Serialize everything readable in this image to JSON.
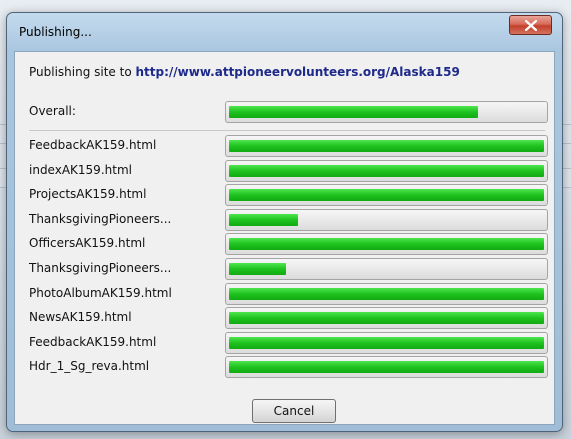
{
  "window": {
    "title": "Publishing..."
  },
  "header": {
    "prefix": "Publishing site to",
    "url": "http://www.attpioneervolunteers.org/Alaska159"
  },
  "overall": {
    "label": "Overall:",
    "progress": 0.79
  },
  "files": [
    {
      "label": "FeedbackAK159.html",
      "progress": 1.0
    },
    {
      "label": "indexAK159.html",
      "progress": 1.0
    },
    {
      "label": "ProjectsAK159.html",
      "progress": 1.0
    },
    {
      "label": "ThanksgivingPioneers...",
      "progress": 0.22
    },
    {
      "label": "OfficersAK159.html",
      "progress": 1.0
    },
    {
      "label": "ThanksgivingPioneers...",
      "progress": 0.18
    },
    {
      "label": "PhotoAlbumAK159.html",
      "progress": 1.0
    },
    {
      "label": "NewsAK159.html",
      "progress": 1.0
    },
    {
      "label": "FeedbackAK159.html",
      "progress": 1.0
    },
    {
      "label": "Hdr_1_Sg_reva.html",
      "progress": 1.0
    }
  ],
  "buttons": {
    "cancel": "Cancel"
  },
  "colors": {
    "progress_fill": "#1ec21e",
    "url_text": "#1d2a8a",
    "close_button": "#c2402b"
  },
  "icons": {
    "close": "close-icon"
  }
}
